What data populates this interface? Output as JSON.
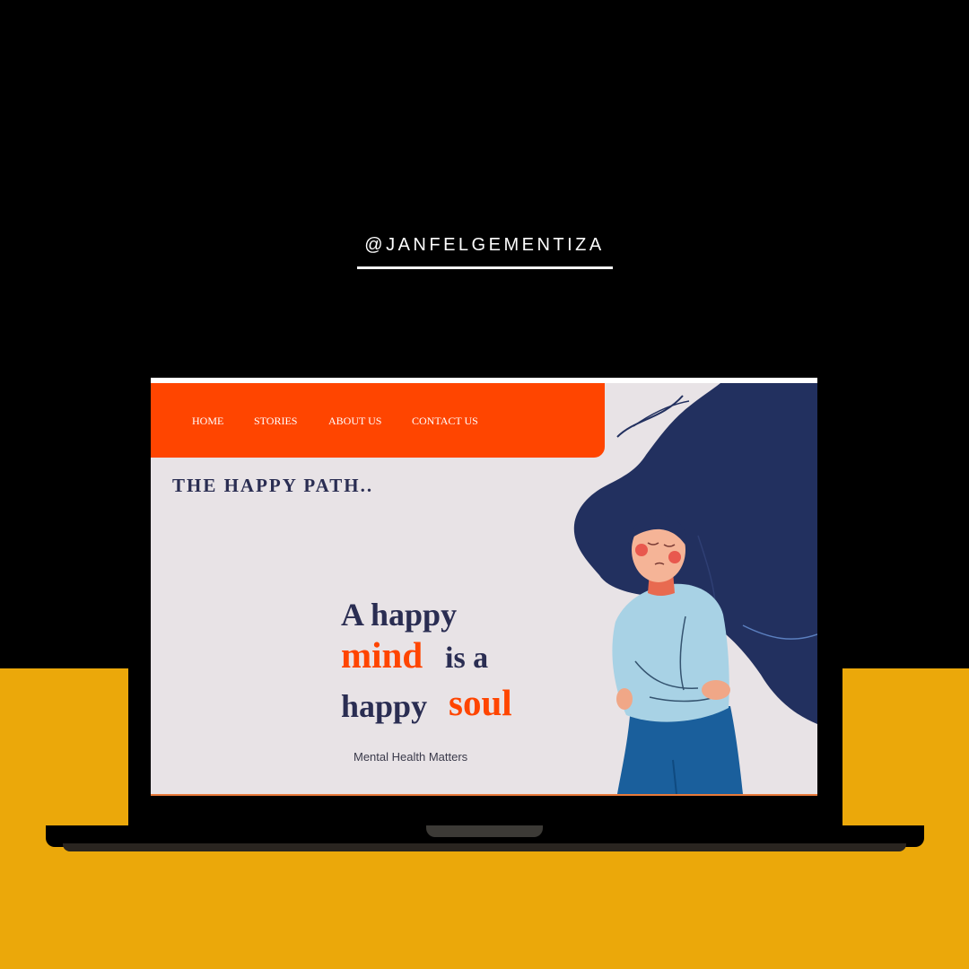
{
  "handle": "@JANFELGEMENTIZA",
  "nav": {
    "items": [
      "HOME",
      "STORIES",
      "ABOUT US",
      "CONTACT US"
    ]
  },
  "brand": "THE HAPPY PATH..",
  "headline": {
    "line1": "A happy",
    "line2_accent": "mind",
    "line2_rest": "is a",
    "line3_rest": "happy",
    "line3_accent": "soul"
  },
  "tagline": "Mental Health Matters",
  "colors": {
    "accent": "#ff4500",
    "navy": "#2a2d52",
    "hair": "#22305f",
    "background_band": "#eba80a",
    "screen_bg": "#e8e3e6"
  },
  "icons": {
    "illustration": "woman-with-flowing-hair-illustration"
  }
}
